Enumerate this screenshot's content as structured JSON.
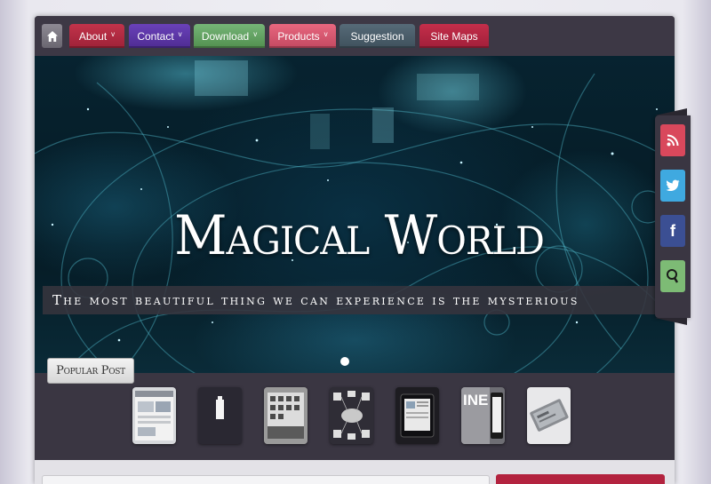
{
  "nav": {
    "home_icon": "home-icon",
    "items": [
      {
        "label": "About",
        "arrow": "v",
        "color": "#b02a42"
      },
      {
        "label": "Contact",
        "arrow": "v",
        "color": "#5d36a8"
      },
      {
        "label": "Download",
        "arrow": "v",
        "color": "#65a466"
      },
      {
        "label": "Products",
        "arrow": "v",
        "color": "#d9586f"
      },
      {
        "label": "Suggestion",
        "arrow": "",
        "color": "#4a5e6b"
      },
      {
        "label": "Site Maps",
        "arrow": "",
        "color": "#b32641"
      }
    ]
  },
  "hero": {
    "title": "Magical World",
    "subtitle": "The most beautiful thing we can experience is the mysterious"
  },
  "social": {
    "icons": [
      "rss-icon",
      "twitter-icon",
      "facebook-icon",
      "search-icon"
    ],
    "facebook_glyph": "f",
    "twitter_glyph": "t",
    "colors": {
      "rss": "#d9485c",
      "twitter": "#3fa9e0",
      "facebook": "#3b4f93",
      "search": "#7dbb75"
    }
  },
  "popular": {
    "label": "Popular Post",
    "thumbnails": [
      "thumbnail-1",
      "thumbnail-2",
      "thumbnail-3",
      "thumbnail-4",
      "thumbnail-5",
      "thumbnail-6",
      "thumbnail-7"
    ],
    "thumb6_text": "INE"
  }
}
